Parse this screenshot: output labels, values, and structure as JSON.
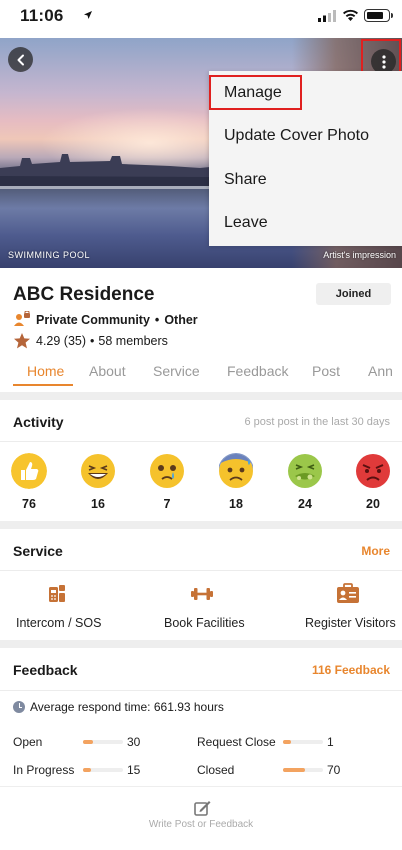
{
  "status_bar": {
    "time": "11:06"
  },
  "cover": {
    "caption_left": "SWIMMING POOL",
    "caption_right": "Artist's impression"
  },
  "menu": {
    "items": [
      "Manage",
      "Update Cover Photo",
      "Share",
      "Leave"
    ]
  },
  "community": {
    "name": "ABC Residence",
    "joined_label": "Joined",
    "type": "Private Community",
    "category": "Other",
    "rating": "4.29 (35)",
    "members": "58 members"
  },
  "tabs": [
    "Home",
    "About",
    "Service",
    "Feedback",
    "Post",
    "Ann"
  ],
  "activity": {
    "title": "Activity",
    "summary": "6 post post in the last 30 days",
    "reactions": [
      {
        "icon": "thumbs-up-icon",
        "count": "76"
      },
      {
        "icon": "laughing-face-icon",
        "count": "16"
      },
      {
        "icon": "crying-face-icon",
        "count": "7"
      },
      {
        "icon": "anxious-sweat-face-icon",
        "count": "18"
      },
      {
        "icon": "nauseated-face-icon",
        "count": "24"
      },
      {
        "icon": "angry-face-icon",
        "count": "20"
      }
    ]
  },
  "service": {
    "title": "Service",
    "more_label": "More",
    "items": [
      {
        "icon": "intercom-icon",
        "label": "Intercom / SOS"
      },
      {
        "icon": "dumbbell-icon",
        "label": "Book Facilities"
      },
      {
        "icon": "visitor-card-icon",
        "label": "Register Visitors"
      }
    ]
  },
  "feedback": {
    "title": "Feedback",
    "count_label": "116 Feedback",
    "avg_respond": "Average respond time: 661.93 hours",
    "stats": [
      {
        "label": "Open",
        "value": "30",
        "fill": 0.25
      },
      {
        "label": "Request Close",
        "value": "1",
        "fill": 0.2
      },
      {
        "label": "In Progress",
        "value": "15",
        "fill": 0.2
      },
      {
        "label": "Closed",
        "value": "70",
        "fill": 0.55
      }
    ]
  },
  "bottom": {
    "write_label": "Write Post or Feedback"
  },
  "colors": {
    "accent": "#e8862e",
    "highlight": "#e0201f"
  }
}
